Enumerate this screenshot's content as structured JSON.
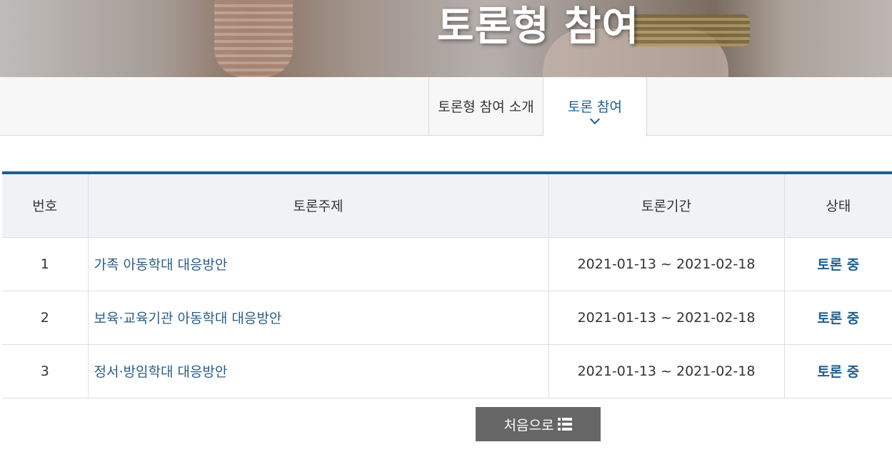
{
  "hero": {
    "title": "토론형 참여"
  },
  "tabs": [
    {
      "label": "토론형 참여 소개",
      "active": false
    },
    {
      "label": "토론 참여",
      "active": true
    }
  ],
  "table": {
    "headers": [
      "번호",
      "토론주제",
      "토론기간",
      "상태"
    ],
    "rows": [
      {
        "no": "1",
        "topic": "가족 아동학대 대응방안",
        "period": "2021-01-13 ~ 2021-02-18",
        "status": "토론 중"
      },
      {
        "no": "2",
        "topic": "보육·교육기관 아동학대 대응방안",
        "period": "2021-01-13 ~ 2021-02-18",
        "status": "토론 중"
      },
      {
        "no": "3",
        "topic": "정서·방임학대 대응방안",
        "period": "2021-01-13 ~ 2021-02-18",
        "status": "토론 중"
      }
    ]
  },
  "first_button": {
    "label": "처음으로",
    "icon": "list-icon"
  },
  "colors": {
    "accent": "#1f5d8e",
    "header_bg": "#f0f2f6",
    "button_bg": "#666666"
  }
}
